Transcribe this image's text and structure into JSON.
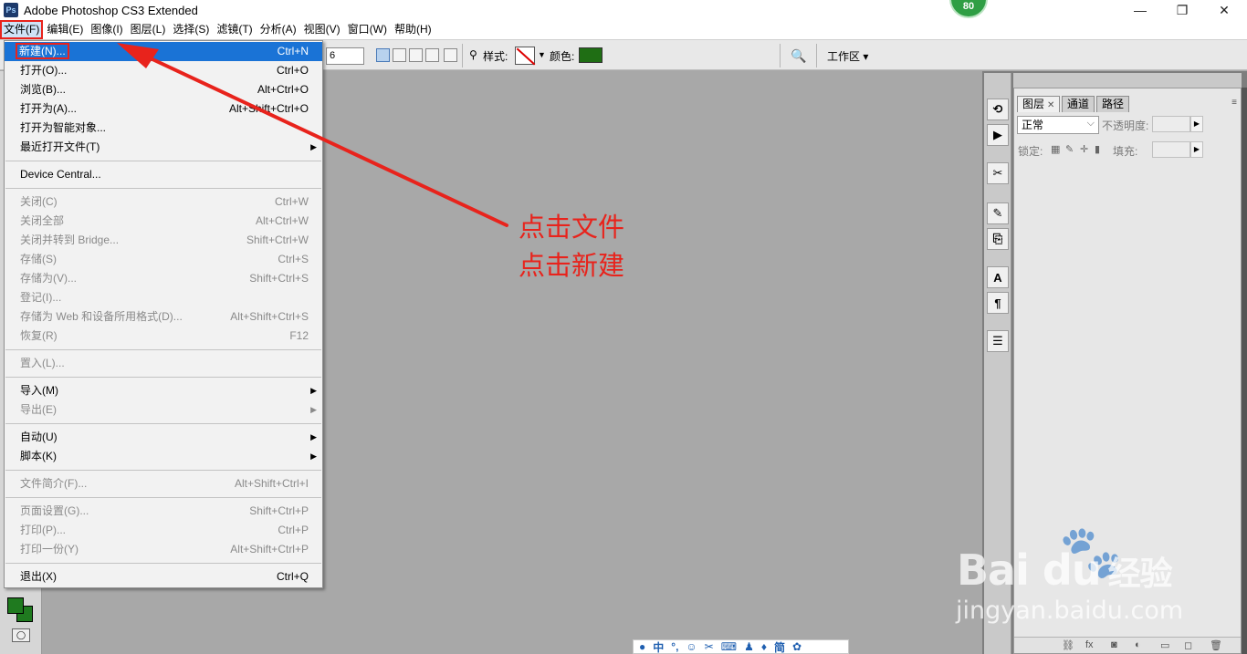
{
  "window": {
    "app_icon": "Ps",
    "title": "Adobe Photoshop CS3 Extended",
    "badge": "80",
    "minimize_glyph": "—",
    "restore_glyph": "❐",
    "close_glyph": "✕"
  },
  "menubar": {
    "items": [
      "文件(F)",
      "编辑(E)",
      "图像(I)",
      "图层(L)",
      "选择(S)",
      "滤镜(T)",
      "分析(A)",
      "视图(V)",
      "窗口(W)",
      "帮助(H)"
    ]
  },
  "options": {
    "feather_value": "6",
    "style_label": "样式:",
    "color_label": "颜色:",
    "color_value": "#1f6e14",
    "workspace_label": "工作区 ▾"
  },
  "file_menu": {
    "items": [
      {
        "label": "新建(N)...",
        "shortcut": "Ctrl+N",
        "highlight": true
      },
      {
        "label": "打开(O)...",
        "shortcut": "Ctrl+O"
      },
      {
        "label": "浏览(B)...",
        "shortcut": "Alt+Ctrl+O"
      },
      {
        "label": "打开为(A)...",
        "shortcut": "Alt+Shift+Ctrl+O"
      },
      {
        "label": "打开为智能对象..."
      },
      {
        "label": "最近打开文件(T)",
        "submenu": true
      },
      {
        "label": "Device Central..."
      },
      {
        "label": "关闭(C)",
        "shortcut": "Ctrl+W",
        "disabled": true
      },
      {
        "label": "关闭全部",
        "shortcut": "Alt+Ctrl+W",
        "disabled": true
      },
      {
        "label": "关闭并转到 Bridge...",
        "shortcut": "Shift+Ctrl+W",
        "disabled": true
      },
      {
        "label": "存储(S)",
        "shortcut": "Ctrl+S",
        "disabled": true
      },
      {
        "label": "存储为(V)...",
        "shortcut": "Shift+Ctrl+S",
        "disabled": true
      },
      {
        "label": "登记(I)...",
        "disabled": true
      },
      {
        "label": "存储为 Web 和设备所用格式(D)...",
        "shortcut": "Alt+Shift+Ctrl+S",
        "disabled": true
      },
      {
        "label": "恢复(R)",
        "shortcut": "F12",
        "disabled": true
      },
      {
        "label": "置入(L)...",
        "disabled": true
      },
      {
        "label": "导入(M)",
        "submenu": true
      },
      {
        "label": "导出(E)",
        "submenu": true,
        "disabled": true
      },
      {
        "label": "自动(U)",
        "submenu": true
      },
      {
        "label": "脚本(K)",
        "submenu": true
      },
      {
        "label": "文件简介(F)...",
        "shortcut": "Alt+Shift+Ctrl+I",
        "disabled": true
      },
      {
        "label": "页面设置(G)...",
        "shortcut": "Shift+Ctrl+P",
        "disabled": true
      },
      {
        "label": "打印(P)...",
        "shortcut": "Ctrl+P",
        "disabled": true
      },
      {
        "label": "打印一份(Y)",
        "shortcut": "Alt+Shift+Ctrl+P",
        "disabled": true
      },
      {
        "label": "退出(X)",
        "shortcut": "Ctrl+Q"
      }
    ]
  },
  "annotation": {
    "line1": "点击文件",
    "line2": "点击新建",
    "color": "#e8231c"
  },
  "layers_panel": {
    "tabs": [
      "图层",
      "通道",
      "路径"
    ],
    "blend_mode": "正常",
    "opacity_label": "不透明度:",
    "lock_label": "锁定:",
    "fill_label": "填充:"
  },
  "toolbox": {
    "foreground_color": "#1f7a1f",
    "background_color": "#1f7a1f"
  },
  "watermark": {
    "logo": "Bai du",
    "brand": "经验",
    "url": "jingyan.baidu.com"
  },
  "ime": {
    "label_zh": "中",
    "label_simplified": "简"
  }
}
